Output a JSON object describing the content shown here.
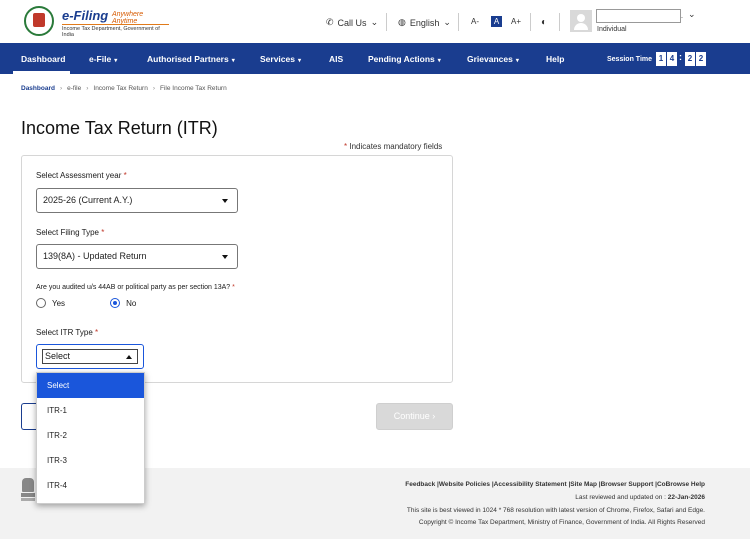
{
  "header": {
    "logo_title": "e-Filing",
    "logo_tagline": "Anywhere Anytime",
    "logo_subtitle": "Income Tax Department, Government of India",
    "call_us": "Call Us",
    "language": "English",
    "font_decrease": "A-",
    "font_normal": "A",
    "font_increase": "A+",
    "user_role": "Individual"
  },
  "nav": {
    "items": [
      {
        "label": "Dashboard",
        "has_dropdown": false
      },
      {
        "label": "e-File",
        "has_dropdown": true
      },
      {
        "label": "Authorised Partners",
        "has_dropdown": true
      },
      {
        "label": "Services",
        "has_dropdown": true
      },
      {
        "label": "AIS",
        "has_dropdown": false
      },
      {
        "label": "Pending Actions",
        "has_dropdown": true
      },
      {
        "label": "Grievances",
        "has_dropdown": true
      },
      {
        "label": "Help",
        "has_dropdown": false
      }
    ],
    "session_label": "Session Time",
    "session_digits": [
      "1",
      "4",
      "2",
      "2"
    ]
  },
  "breadcrumb": [
    "Dashboard",
    "e-file",
    "Income Tax Return",
    "File Income Tax Return"
  ],
  "page_title": "Income Tax Return (ITR)",
  "mandatory_note": "Indicates mandatory fields",
  "form": {
    "assessment_year_label": "Select Assessment year",
    "assessment_year_value": "2025-26  (Current A.Y.)",
    "filing_type_label": "Select Filing Type",
    "filing_type_value": "139(8A) - Updated Return",
    "audit_question": "Are you audited u/s 44AB or political party as per section 13A?",
    "audit_options": [
      {
        "label": "Yes",
        "checked": false
      },
      {
        "label": "No",
        "checked": true
      }
    ],
    "itr_type_label": "Select ITR Type",
    "itr_type_value": "Select",
    "itr_options": [
      {
        "label": "Select",
        "selected": true
      },
      {
        "label": "ITR-1",
        "selected": false
      },
      {
        "label": "ITR-2",
        "selected": false
      },
      {
        "label": "ITR-3",
        "selected": false
      },
      {
        "label": "ITR-4",
        "selected": false
      }
    ],
    "continue_label": "Continue"
  },
  "footer": {
    "links": "Feedback |Website Policies |Accessibility Statement |Site Map |Browser Support |CoBrowse Help",
    "last_reviewed_label": "Last reviewed and updated on :",
    "last_reviewed_date": "22-Jan-2026",
    "best_viewed": "This site is best viewed in 1024 * 768 resolution with latest version of Chrome, Firefox, Safari and Edge.",
    "copyright": "Copyright © Income Tax Department, Ministry of Finance, Government of India. All Rights Reserved"
  },
  "colors": {
    "nav_bg": "#1a3d8f",
    "accent": "#1a56db",
    "required_star": "#c0392b"
  }
}
